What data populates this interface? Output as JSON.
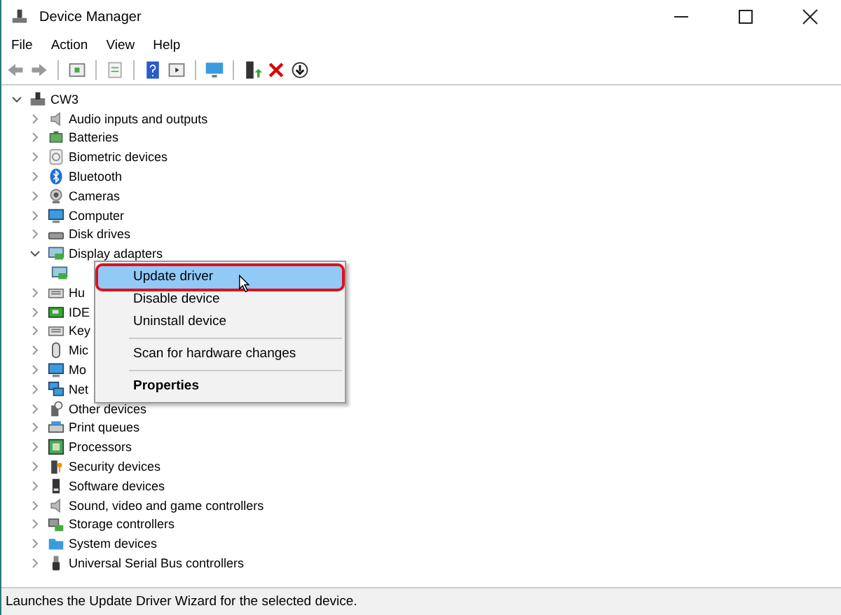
{
  "window": {
    "title": "Device Manager"
  },
  "menu": [
    "File",
    "Action",
    "View",
    "Help"
  ],
  "tree": {
    "label": "CW3",
    "expanded": true,
    "children": [
      {
        "label": "Audio inputs and outputs",
        "expanded": false
      },
      {
        "label": "Batteries",
        "expanded": false
      },
      {
        "label": "Biometric devices",
        "expanded": false
      },
      {
        "label": "Bluetooth",
        "expanded": false
      },
      {
        "label": "Cameras",
        "expanded": false
      },
      {
        "label": "Computer",
        "expanded": false
      },
      {
        "label": "Disk drives",
        "expanded": false
      },
      {
        "label": "Display adapters",
        "expanded": true,
        "children": [
          {
            "kind": "device"
          }
        ]
      },
      {
        "label": "Hu",
        "expanded": false
      },
      {
        "label": "IDE",
        "expanded": false
      },
      {
        "label": "Key",
        "expanded": false
      },
      {
        "label": "Mic",
        "expanded": false
      },
      {
        "label": "Mo",
        "expanded": false
      },
      {
        "label": "Net",
        "expanded": false
      },
      {
        "label": "Other devices",
        "expanded": false
      },
      {
        "label": "Print queues",
        "expanded": false
      },
      {
        "label": "Processors",
        "expanded": false
      },
      {
        "label": "Security devices",
        "expanded": false
      },
      {
        "label": "Software devices",
        "expanded": false
      },
      {
        "label": "Sound, video and game controllers",
        "expanded": false
      },
      {
        "label": "Storage controllers",
        "expanded": false
      },
      {
        "label": "System devices",
        "expanded": false
      },
      {
        "label": "Universal Serial Bus controllers",
        "expanded": false
      }
    ]
  },
  "context_menu": [
    {
      "kind": "item",
      "label": "Update driver",
      "selected": true
    },
    {
      "kind": "item",
      "label": "Disable device",
      "selected": false
    },
    {
      "kind": "item",
      "label": "Uninstall device",
      "selected": false
    },
    {
      "kind": "separator"
    },
    {
      "kind": "item",
      "label": "Scan for hardware changes",
      "selected": false
    },
    {
      "kind": "separator"
    },
    {
      "kind": "default",
      "label": "Properties",
      "selected": false
    }
  ],
  "status_bar": "Launches the Update Driver Wizard for the selected device."
}
